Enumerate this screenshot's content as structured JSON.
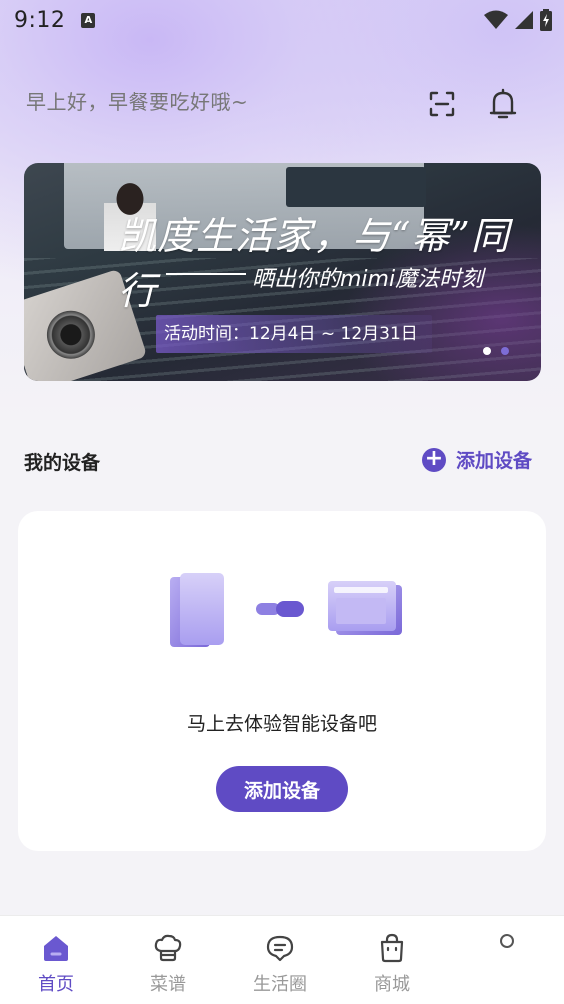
{
  "status_bar": {
    "time": "9:12",
    "notification_icon_letter": "A"
  },
  "header": {
    "greeting": "早上好，早餐要吃好哦~",
    "icons": [
      "scan-icon",
      "bell-icon"
    ]
  },
  "banner": {
    "title": "凯度生活家，与“幂”同行",
    "subtitle": "晒出你的mimi魔法时刻",
    "date": "活动时间：12月4日 ~ 12月31日",
    "page_count": 2,
    "active_page": 1
  },
  "devices": {
    "section_title": "我的设备",
    "add_link_label": "添加设备",
    "empty_text": "马上去体验智能设备吧",
    "add_button_label": "添加设备"
  },
  "tabs": [
    {
      "label": "首页",
      "icon": "home-icon",
      "active": true
    },
    {
      "label": "菜谱",
      "icon": "chef-hat-icon",
      "active": false
    },
    {
      "label": "生活圈",
      "icon": "chat-bubble-icon",
      "active": false
    },
    {
      "label": "商城",
      "icon": "shopping-bag-icon",
      "active": false
    }
  ],
  "colors": {
    "accent": "#5f4bc4",
    "background": "#f4f3f7",
    "card": "#ffffff",
    "inactive_tab": "#999999"
  }
}
